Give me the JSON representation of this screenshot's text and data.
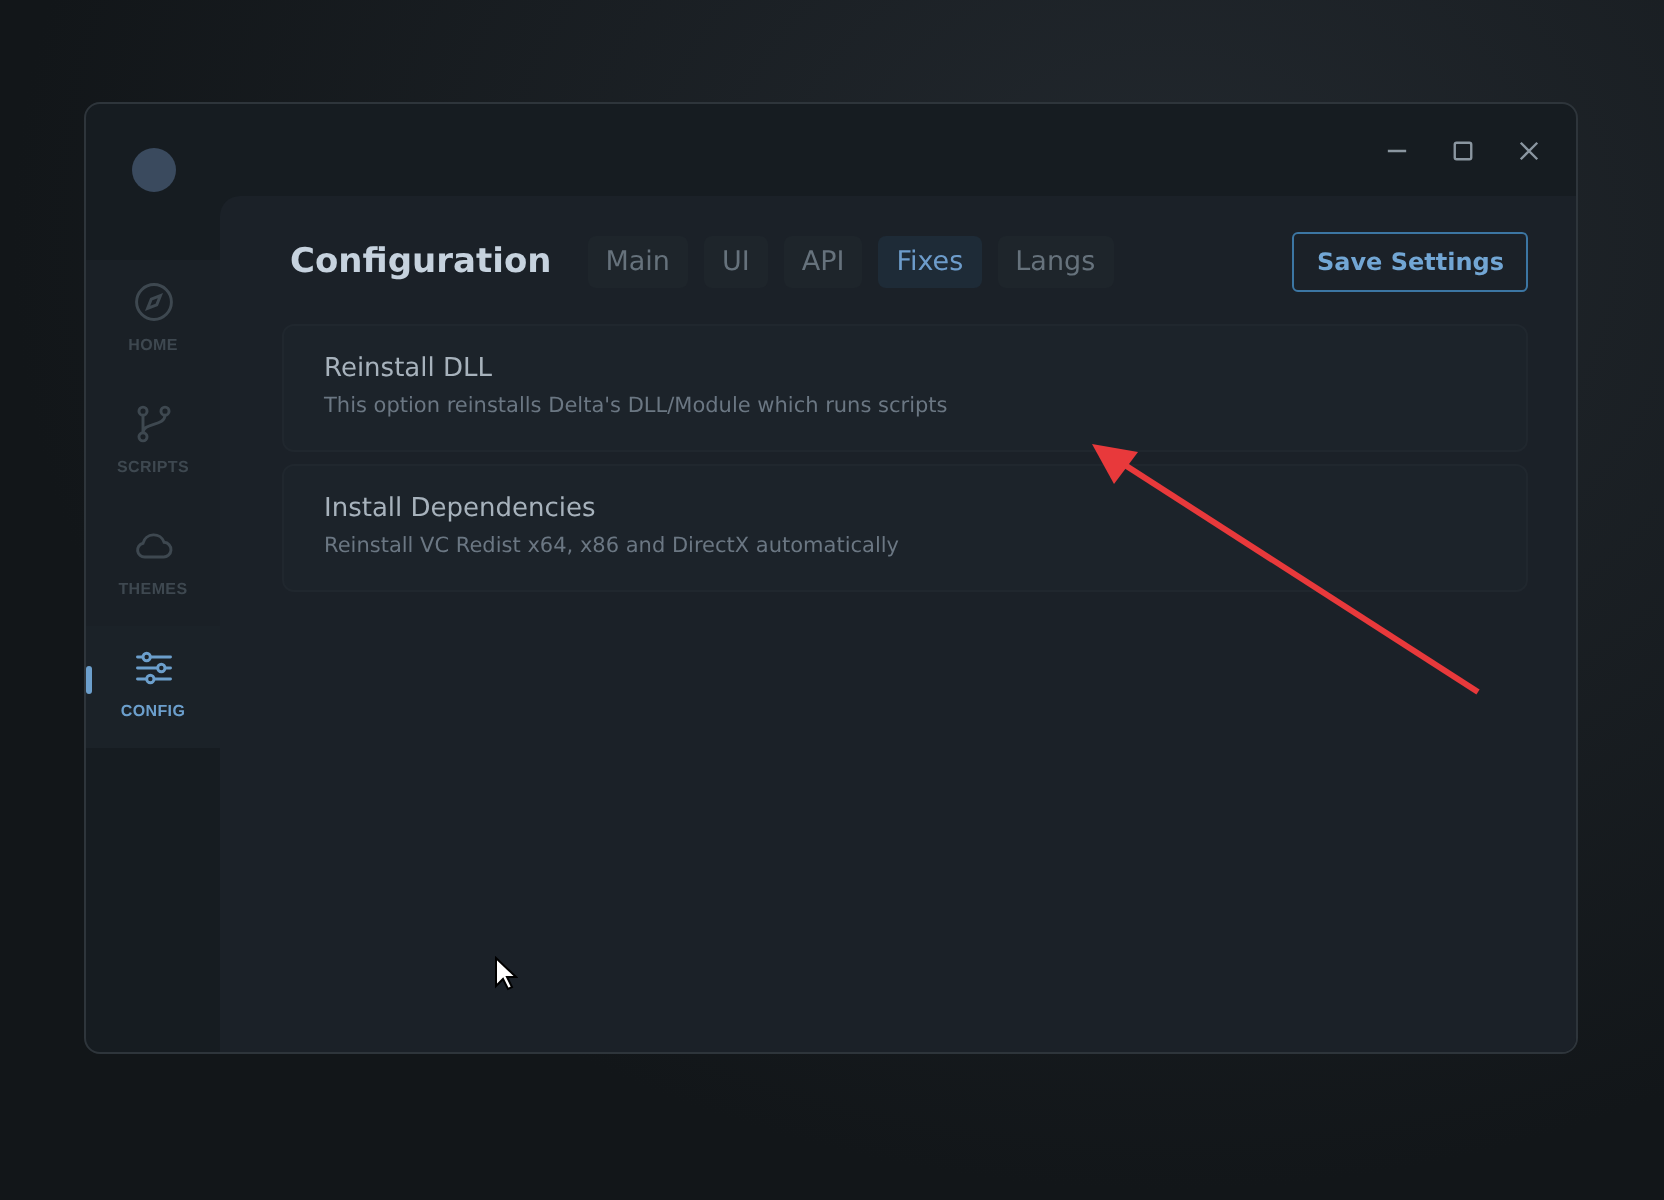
{
  "sidebar": {
    "items": [
      {
        "label": "HOME",
        "selected": false
      },
      {
        "label": "SCRIPTS",
        "selected": false
      },
      {
        "label": "THEMES",
        "selected": false
      },
      {
        "label": "CONFIG",
        "selected": true
      }
    ]
  },
  "header": {
    "title": "Configuration",
    "tabs": [
      {
        "label": "Main",
        "selected": false
      },
      {
        "label": "UI",
        "selected": false
      },
      {
        "label": "API",
        "selected": false
      },
      {
        "label": "Fixes",
        "selected": true
      },
      {
        "label": "Langs",
        "selected": false
      }
    ],
    "save_button": "Save Settings"
  },
  "options": [
    {
      "title": "Reinstall DLL",
      "description": "This option reinstalls Delta's DLL/Module which runs scripts"
    },
    {
      "title": "Install Dependencies",
      "description": "Reinstall VC Redist x64, x86 and DirectX automatically"
    }
  ]
}
